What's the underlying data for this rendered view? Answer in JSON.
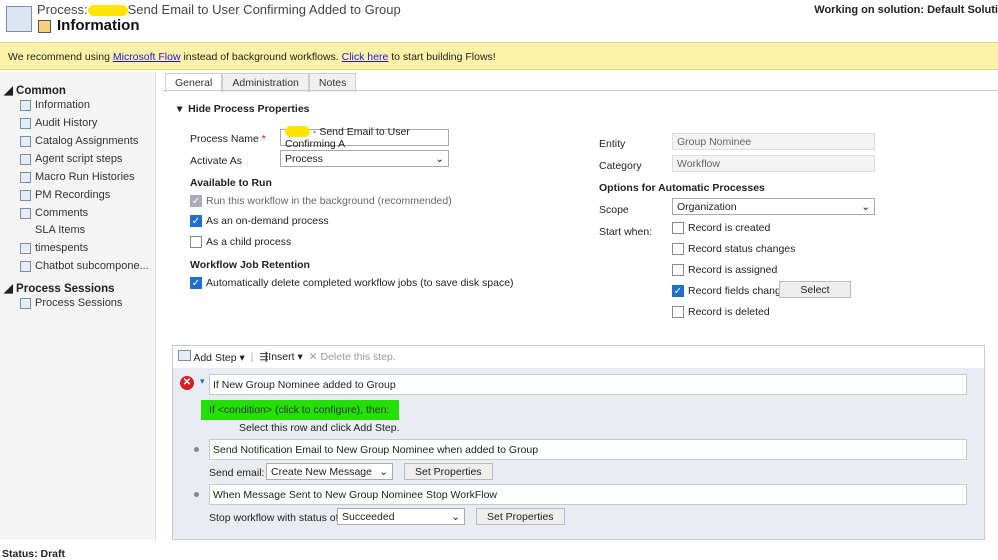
{
  "header": {
    "process_prefix": "Process:",
    "process_name": "Send Email to User Confirming Added to Group",
    "title": "Information",
    "solution": "Working on solution: Default Soluti"
  },
  "banner": {
    "text1": "We recommend using ",
    "link1": "Microsoft Flow",
    "text2": " instead of background workflows. ",
    "link2": "Click here",
    "text3": " to start building Flows!"
  },
  "sidebar": {
    "common": "Common",
    "items": [
      "Information",
      "Audit History",
      "Catalog Assignments",
      "Agent script steps",
      "Macro Run Histories",
      "PM Recordings",
      "Comments",
      "SLA Items",
      "timespents",
      "Chatbot subcompone..."
    ],
    "sessions": "Process Sessions",
    "session_items": [
      "Process Sessions"
    ]
  },
  "tabs": [
    "General",
    "Administration",
    "Notes"
  ],
  "form": {
    "hide_props": "Hide Process Properties",
    "process_name_label": "Process Name",
    "process_name_value": "- Send Email to User Confirming A",
    "activate_as_label": "Activate As",
    "activate_as_value": "Process",
    "available": "Available to Run",
    "run_bg": "Run this workflow in the background (recommended)",
    "on_demand": "As an on-demand process",
    "child": "As a child process",
    "retention": "Workflow Job Retention",
    "auto_delete": "Automatically delete completed workflow jobs (to save disk space)",
    "entity_label": "Entity",
    "entity_value": "Group Nominee",
    "category_label": "Category",
    "category_value": "Workflow",
    "options": "Options for Automatic Processes",
    "scope_label": "Scope",
    "scope_value": "Organization",
    "start_when": "Start when:",
    "starts": [
      "Record is created",
      "Record status changes",
      "Record is assigned",
      "Record fields change",
      "Record is deleted"
    ],
    "starts_checked": [
      false,
      false,
      false,
      true,
      false
    ],
    "select_btn": "Select"
  },
  "designer": {
    "add_step": "Add Step",
    "insert": "Insert",
    "delete": "Delete this step.",
    "if_step": "If New Group Nominee added to Group",
    "condition": "If <condition> (click to configure), then:",
    "hint": "Select this row and click Add Step.",
    "step1": "Send Notification Email to New Group Nominee when added to Group",
    "send_email_label": "Send email:",
    "send_email_value": "Create New Message",
    "set_props": "Set Properties",
    "step2": "When Message Sent to New Group Nominee Stop WorkFlow",
    "stop_label": "Stop workflow with status of:",
    "stop_value": "Succeeded"
  },
  "status": "Status: Draft",
  "colors": {
    "banner": "#fdf2a8",
    "highlight": "#22e000",
    "link": "#1a1ad6",
    "check": "#1f6fd0"
  }
}
